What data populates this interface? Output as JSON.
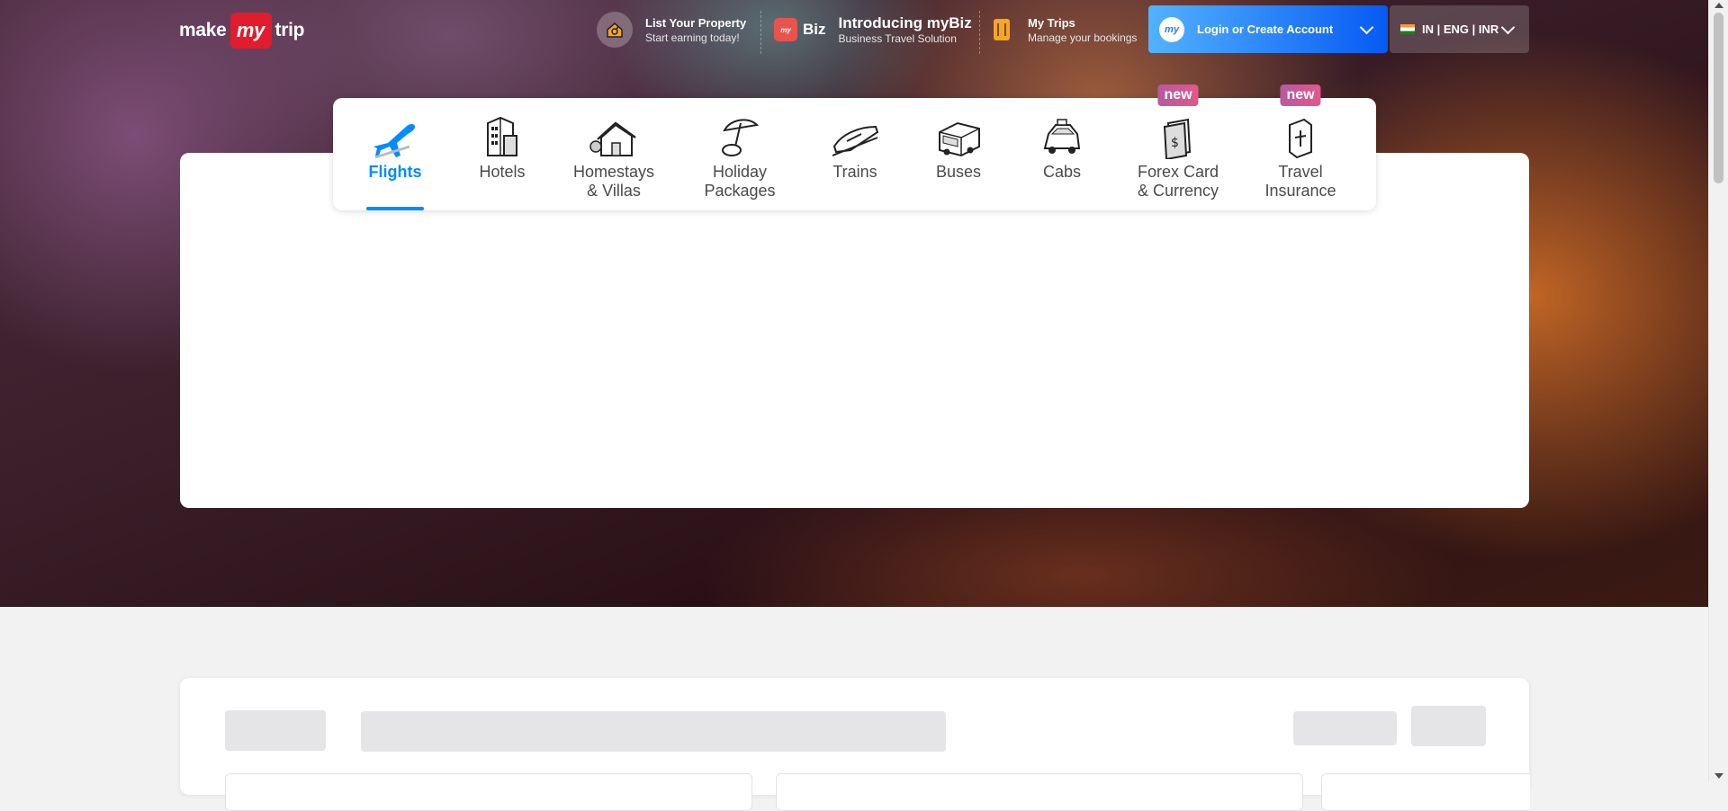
{
  "brand": {
    "logo_left": "make",
    "logo_mid": "my",
    "logo_right": "trip"
  },
  "header": {
    "list_property": {
      "title": "List Your Property",
      "subtitle": "Start earning today!"
    },
    "mybiz": {
      "badge": "Biz",
      "title": "Introducing myBiz",
      "subtitle": "Business Travel Solution"
    },
    "my_trips": {
      "title": "My Trips",
      "subtitle": "Manage your bookings"
    },
    "login": {
      "avatar": "my",
      "label": "Login or Create Account"
    },
    "locale": {
      "label": "IN | ENG | INR"
    }
  },
  "lob_tabs": [
    {
      "label_1": "Flights",
      "label_2": "",
      "icon": "plane-icon",
      "active": true,
      "badge": ""
    },
    {
      "label_1": "Hotels",
      "label_2": "",
      "icon": "hotel-icon",
      "active": false,
      "badge": ""
    },
    {
      "label_1": "Homestays",
      "label_2": "& Villas",
      "icon": "homestay-icon",
      "active": false,
      "badge": ""
    },
    {
      "label_1": "Holiday",
      "label_2": "Packages",
      "icon": "holiday-icon",
      "active": false,
      "badge": ""
    },
    {
      "label_1": "Trains",
      "label_2": "",
      "icon": "train-icon",
      "active": false,
      "badge": ""
    },
    {
      "label_1": "Buses",
      "label_2": "",
      "icon": "bus-icon",
      "active": false,
      "badge": ""
    },
    {
      "label_1": "Cabs",
      "label_2": "",
      "icon": "cab-icon",
      "active": false,
      "badge": ""
    },
    {
      "label_1": "Forex Card",
      "label_2": "& Currency",
      "icon": "forex-icon",
      "active": false,
      "badge": "new"
    },
    {
      "label_1": "Travel",
      "label_2": "Insurance",
      "icon": "insurance-icon",
      "active": false,
      "badge": "new"
    }
  ],
  "colors": {
    "accent": "#008cff",
    "brand_red": "#e11c2c",
    "badge": "#c05a9a"
  }
}
